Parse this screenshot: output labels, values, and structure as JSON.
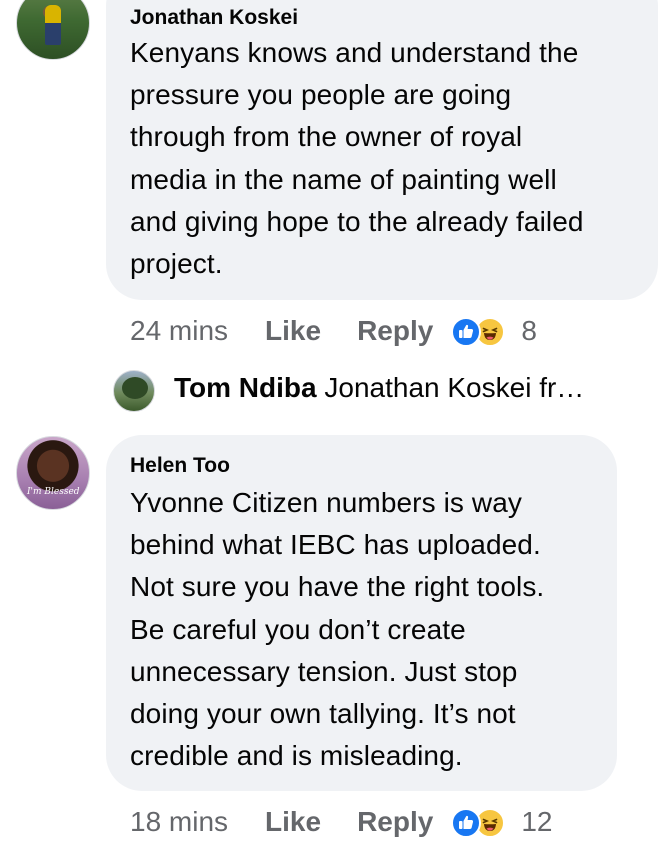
{
  "comments": [
    {
      "author": "Jonathan Koskei",
      "lines": [
        "Kenyans knows and understand the",
        "pressure you people are going",
        "through from the owner of royal",
        "media in the name of painting well",
        "and giving hope to the already failed",
        "project."
      ],
      "time": "24 mins",
      "like_label": "Like",
      "reply_label": "Reply",
      "reaction_count": "8"
    },
    {
      "author": "Helen Too",
      "lines": [
        "Yvonne Citizen numbers is way",
        "behind what IEBC has uploaded.",
        "Not sure you have the right tools.",
        "Be careful you don’t create",
        "unnecessary tension. Just stop",
        "doing your own tallying. It’s not",
        "credible and is misleading."
      ],
      "time": "18 mins",
      "like_label": "Like",
      "reply_label": "Reply",
      "reaction_count": "12"
    }
  ],
  "reply_preview": {
    "author": "Tom Ndiba",
    "snippet": "Jonathan Koskei fr…"
  },
  "avatar_3_signature": "I'm Blessed",
  "icons": {
    "like_reaction": "thumbs-up-icon",
    "haha_reaction": "laughing-face-icon"
  },
  "colors": {
    "bubble": "#f0f2f5",
    "meta_text": "#65676b",
    "like_blue": "#1877f2",
    "haha_yellow": "#f7c640"
  }
}
